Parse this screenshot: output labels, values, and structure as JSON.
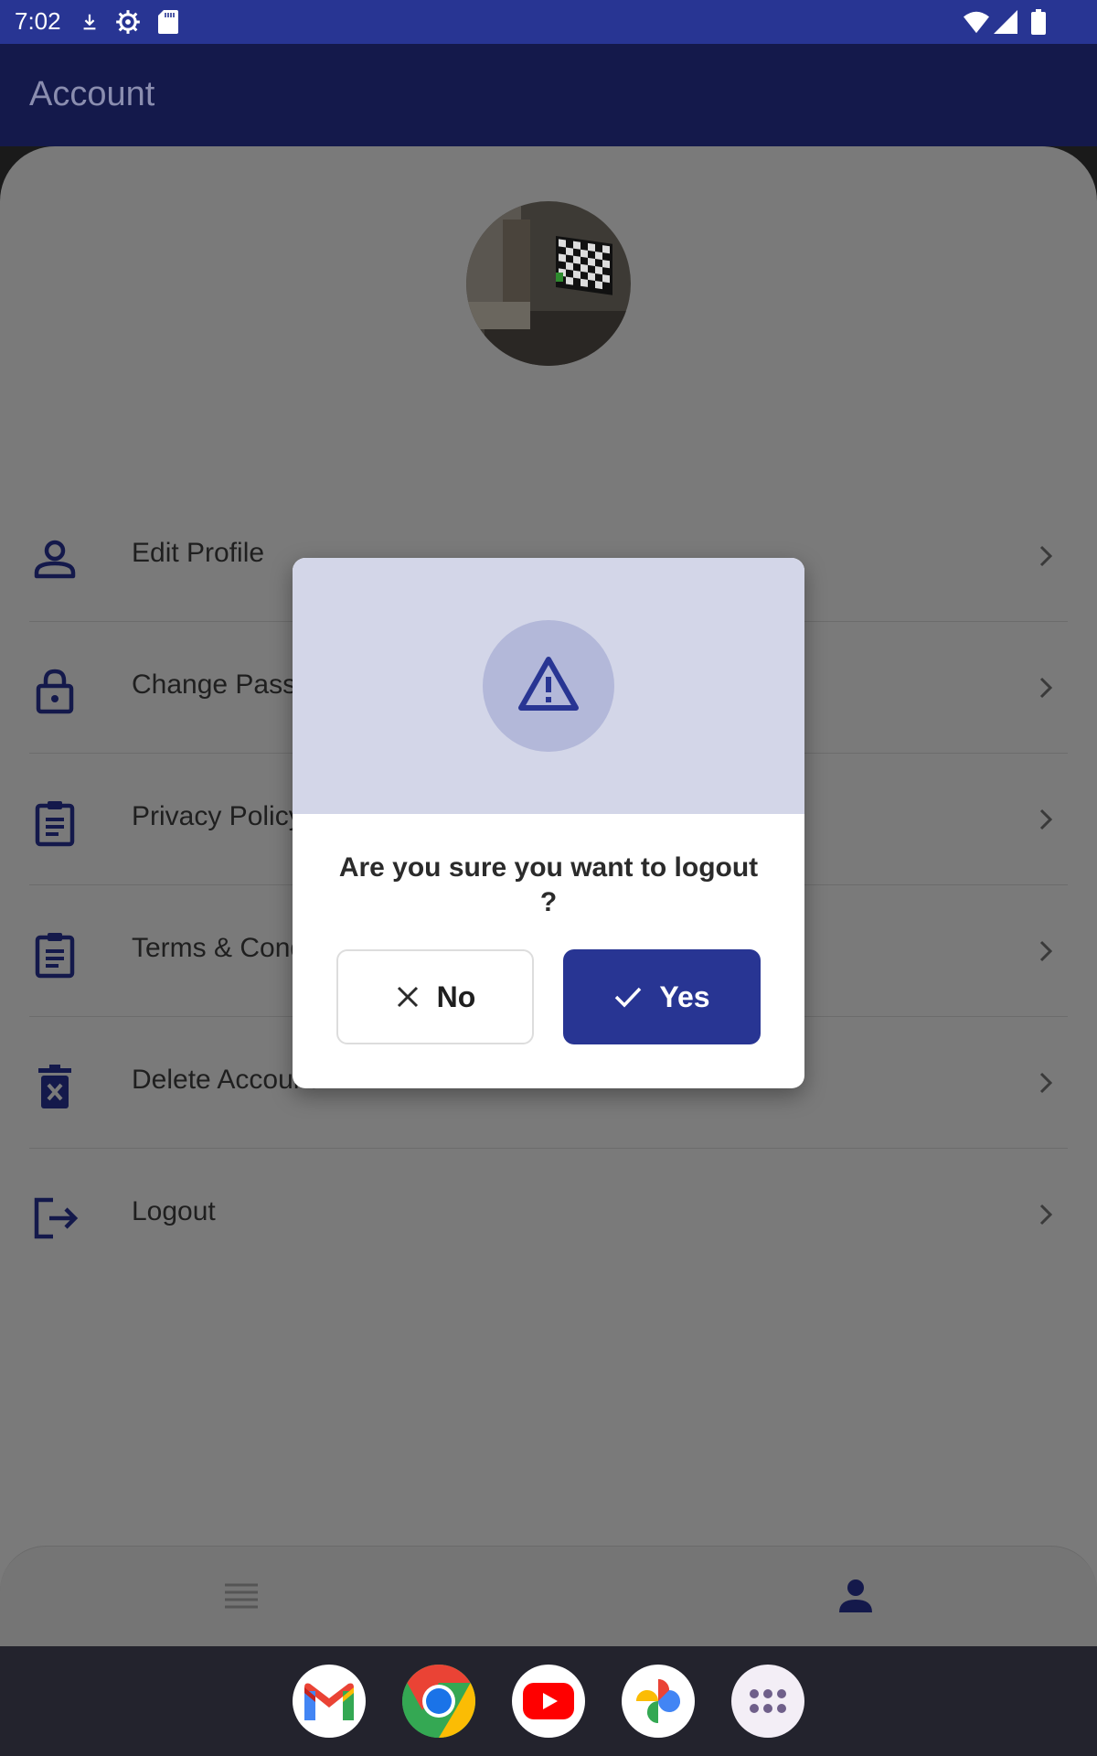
{
  "status_bar": {
    "time": "7:02",
    "icons": [
      "download-icon",
      "settings-icon",
      "sd-card-icon",
      "wifi-icon",
      "signal-icon",
      "battery-icon"
    ]
  },
  "app_bar": {
    "title": "Account"
  },
  "profile": {
    "avatar": "profile-avatar-image"
  },
  "menu": {
    "items": [
      {
        "label": "Edit Profile",
        "icon": "person-icon"
      },
      {
        "label": "Change Password",
        "icon": "lock-icon"
      },
      {
        "label": "Privacy Policy",
        "icon": "clipboard-icon"
      },
      {
        "label": "Terms & Conditions",
        "icon": "clipboard-icon"
      },
      {
        "label": "Delete Account",
        "icon": "delete-icon"
      },
      {
        "label": "Logout",
        "icon": "logout-icon"
      }
    ]
  },
  "bottom_nav": {
    "items": [
      {
        "icon": "list-icon",
        "active": false
      },
      {
        "icon": "person-icon",
        "active": true
      }
    ]
  },
  "dialog": {
    "icon": "warning-icon",
    "message": "Are you sure you want to logout ?",
    "no_label": "No",
    "yes_label": "Yes"
  },
  "dock": {
    "apps": [
      "gmail-icon",
      "chrome-icon",
      "youtube-icon",
      "photos-icon",
      "app-drawer-icon"
    ]
  },
  "colors": {
    "primary": "#283593",
    "app_bar": "#14194b",
    "scrim_content": "#7a7a7a",
    "dialog_header": "#d3d6e8",
    "warning_circle": "#b3b8d9"
  }
}
